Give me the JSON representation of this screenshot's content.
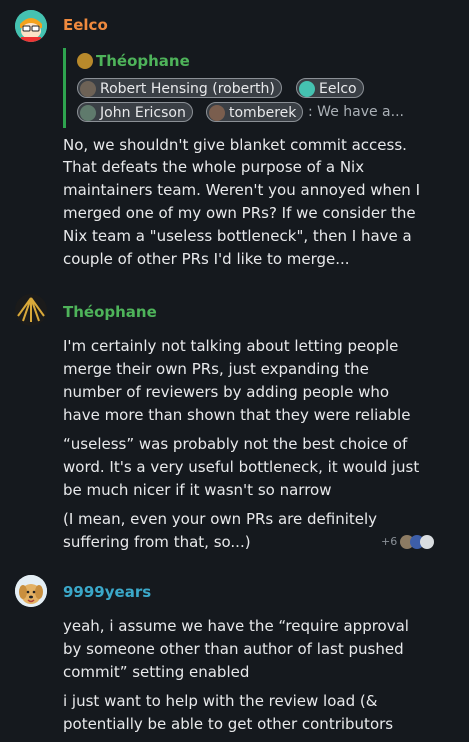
{
  "messages": [
    {
      "sender": "Eelco",
      "sender_color": "#f08a3e",
      "avatar_icon": "cartoon-scientist-avatar",
      "reply": {
        "to": "Théophane",
        "mentions": [
          "Robert Hensing (roberth)",
          "Eelco",
          "John Ericson",
          "tomberek"
        ],
        "preview": ": We have a..."
      },
      "lines": [
        "No, we shouldn't give blanket commit access.",
        "That defeats the whole purpose of a Nix",
        "maintainers team. Weren't you annoyed when I",
        "merged one of my own PRs? If we consider the",
        "Nix team a \"useless bottleneck\", then I have a",
        "couple of other PRs I'd like to merge..."
      ]
    },
    {
      "sender": "Théophane",
      "sender_color": "#4eb35a",
      "avatar_icon": "golden-shell-avatar",
      "paragraphs": [
        [
          "I'm certainly not talking about letting people",
          "merge their own PRs, just expanding the",
          "number of reviewers by adding people who",
          "have more than shown that they were reliable"
        ],
        [
          "“useless” was probably not the best choice of",
          "word. It's a very useful bottleneck, it would just",
          "be much nicer if it wasn't so narrow"
        ],
        [
          "(I mean, even your own PRs are definitely",
          "suffering from that, so...)"
        ]
      ],
      "read_receipts": "+6"
    },
    {
      "sender": "9999years",
      "sender_color": "#3ba8c9",
      "avatar_icon": "golden-retriever-avatar",
      "paragraphs": [
        [
          "yeah, i assume we have the “require approval",
          "by someone other than author of last pushed",
          "commit” setting enabled"
        ],
        [
          "i just want to help with the review load (&",
          "potentially be able to get other contributors"
        ]
      ]
    }
  ]
}
